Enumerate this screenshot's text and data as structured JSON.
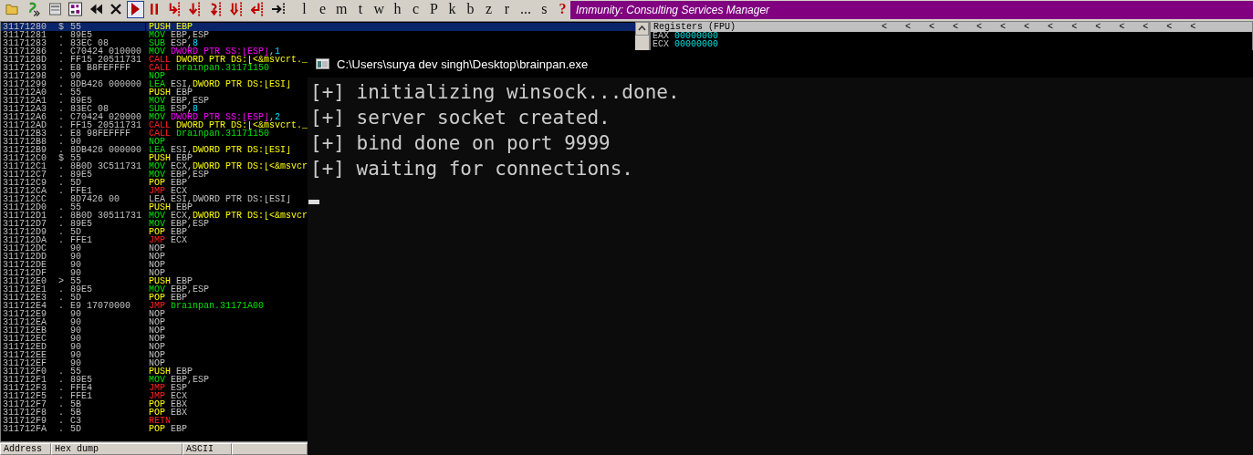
{
  "toolbar": {
    "icon_buttons": [
      {
        "kind": "open",
        "selected": false
      },
      {
        "kind": "script",
        "selected": false
      },
      {
        "kind": "window",
        "selected": false
      },
      {
        "kind": "grid",
        "selected": false
      },
      {
        "kind": "rewind",
        "selected": false
      },
      {
        "kind": "close",
        "selected": false
      },
      {
        "kind": "run",
        "selected": true
      },
      {
        "kind": "pause",
        "selected": false
      },
      {
        "kind": "step-into",
        "selected": false
      },
      {
        "kind": "step-over",
        "selected": false
      },
      {
        "kind": "trace-into",
        "selected": false
      },
      {
        "kind": "trace-over",
        "selected": false
      },
      {
        "kind": "run-to-return",
        "selected": false
      },
      {
        "kind": "go-to",
        "selected": false
      }
    ],
    "letter_buttons": [
      {
        "label": "l",
        "kind": "plain"
      },
      {
        "label": "e",
        "kind": "plain"
      },
      {
        "label": "m",
        "kind": "plain"
      },
      {
        "label": "t",
        "kind": "plain"
      },
      {
        "label": "w",
        "kind": "plain"
      },
      {
        "label": "h",
        "kind": "plain"
      },
      {
        "label": "c",
        "kind": "plain"
      },
      {
        "label": "P",
        "kind": "plain"
      },
      {
        "label": "k",
        "kind": "plain"
      },
      {
        "label": "b",
        "kind": "plain"
      },
      {
        "label": "z",
        "kind": "plain"
      },
      {
        "label": "r",
        "kind": "plain"
      },
      {
        "label": "...",
        "kind": "plain"
      },
      {
        "label": "s",
        "kind": "plain"
      },
      {
        "label": "?",
        "kind": "help"
      }
    ]
  },
  "window": {
    "title": "Immunity: Consulting Services Manager"
  },
  "disassembly": {
    "rows": [
      {
        "address": "31171280",
        "mark": "$",
        "hex": "55",
        "selected": true,
        "ins": [
          {
            "text": "PUSH EBP",
            "kind": "stack"
          }
        ]
      },
      {
        "address": "31171281",
        "mark": ".",
        "hex": "89E5",
        "selected": false,
        "ins": [
          {
            "text": "MOV",
            "kind": "op"
          },
          {
            "text": " EBP,ESP",
            "kind": "reg"
          }
        ]
      },
      {
        "address": "31171283",
        "mark": ".",
        "hex": "83EC 08",
        "selected": false,
        "ins": [
          {
            "text": "SUB",
            "kind": "op"
          },
          {
            "text": " ESP,",
            "kind": "reg"
          },
          {
            "text": "8",
            "kind": "imm"
          }
        ]
      },
      {
        "address": "31171286",
        "mark": ".",
        "hex": "C70424 010000",
        "selected": false,
        "ins": [
          {
            "text": "MOV",
            "kind": "op"
          },
          {
            "text": " DWORD PTR SS:[ESP]",
            "kind": "mem"
          },
          {
            "text": ",",
            "kind": "reg"
          },
          {
            "text": "1",
            "kind": "imm"
          }
        ]
      },
      {
        "address": "3117128D",
        "mark": ".",
        "hex": "FF15 20511731",
        "selected": false,
        "ins": [
          {
            "text": "CALL",
            "kind": "flow"
          },
          {
            "text": " DWORD PTR DS:[<&msvcrt._",
            "kind": "data"
          }
        ]
      },
      {
        "address": "31171293",
        "mark": ".",
        "hex": "E8 B8FEFFFF",
        "selected": false,
        "ins": [
          {
            "text": "CALL",
            "kind": "flow"
          },
          {
            "text": " brainpan.31171150",
            "kind": "label"
          }
        ]
      },
      {
        "address": "31171298",
        "mark": ".",
        "hex": "90",
        "selected": false,
        "ins": [
          {
            "text": "NOP",
            "kind": "op"
          }
        ]
      },
      {
        "address": "31171299",
        "mark": ".",
        "hex": "8DB426 000000",
        "selected": false,
        "ins": [
          {
            "text": "LEA",
            "kind": "op"
          },
          {
            "text": " ESI,",
            "kind": "reg"
          },
          {
            "text": "DWORD PTR DS:[ESI]",
            "kind": "data"
          }
        ]
      },
      {
        "address": "311712A0",
        "mark": ".",
        "hex": "55",
        "selected": false,
        "ins": [
          {
            "text": "PUSH",
            "kind": "stack"
          },
          {
            "text": " EBP",
            "kind": "reg"
          }
        ]
      },
      {
        "address": "311712A1",
        "mark": ".",
        "hex": "89E5",
        "selected": false,
        "ins": [
          {
            "text": "MOV",
            "kind": "op"
          },
          {
            "text": " EBP,ESP",
            "kind": "reg"
          }
        ]
      },
      {
        "address": "311712A3",
        "mark": ".",
        "hex": "83EC 08",
        "selected": false,
        "ins": [
          {
            "text": "SUB",
            "kind": "op"
          },
          {
            "text": " ESP,",
            "kind": "reg"
          },
          {
            "text": "8",
            "kind": "imm"
          }
        ]
      },
      {
        "address": "311712A6",
        "mark": ".",
        "hex": "C70424 020000",
        "selected": false,
        "ins": [
          {
            "text": "MOV",
            "kind": "op"
          },
          {
            "text": " DWORD PTR SS:[ESP]",
            "kind": "mem"
          },
          {
            "text": ",",
            "kind": "reg"
          },
          {
            "text": "2",
            "kind": "imm"
          }
        ]
      },
      {
        "address": "311712AD",
        "mark": ".",
        "hex": "FF15 20511731",
        "selected": false,
        "ins": [
          {
            "text": "CALL",
            "kind": "flow"
          },
          {
            "text": " DWORD PTR DS:[<&msvcrt._",
            "kind": "data"
          }
        ]
      },
      {
        "address": "311712B3",
        "mark": ".",
        "hex": "E8 98FEFFFF",
        "selected": false,
        "ins": [
          {
            "text": "CALL",
            "kind": "flow"
          },
          {
            "text": " brainpan.31171150",
            "kind": "label"
          }
        ]
      },
      {
        "address": "311712B8",
        "mark": ".",
        "hex": "90",
        "selected": false,
        "ins": [
          {
            "text": "NOP",
            "kind": "op"
          }
        ]
      },
      {
        "address": "311712B9",
        "mark": ".",
        "hex": "8DB426 000000",
        "selected": false,
        "ins": [
          {
            "text": "LEA",
            "kind": "op"
          },
          {
            "text": " ESI,",
            "kind": "reg"
          },
          {
            "text": "DWORD PTR DS:[ESI]",
            "kind": "data"
          }
        ]
      },
      {
        "address": "311712C0",
        "mark": "$",
        "hex": "55",
        "selected": false,
        "ins": [
          {
            "text": "PUSH",
            "kind": "stack"
          },
          {
            "text": " EBP",
            "kind": "reg"
          }
        ]
      },
      {
        "address": "311712C1",
        "mark": ".",
        "hex": "8B0D 3C511731",
        "selected": false,
        "ins": [
          {
            "text": "MOV",
            "kind": "op"
          },
          {
            "text": " ECX,",
            "kind": "reg"
          },
          {
            "text": "DWORD PTR DS:[<&msvcr",
            "kind": "data"
          }
        ]
      },
      {
        "address": "311712C7",
        "mark": ".",
        "hex": "89E5",
        "selected": false,
        "ins": [
          {
            "text": "MOV",
            "kind": "op"
          },
          {
            "text": " EBP,ESP",
            "kind": "reg"
          }
        ]
      },
      {
        "address": "311712C9",
        "mark": ".",
        "hex": "5D",
        "selected": false,
        "ins": [
          {
            "text": "POP",
            "kind": "stack"
          },
          {
            "text": " EBP",
            "kind": "reg"
          }
        ]
      },
      {
        "address": "311712CA",
        "mark": ".",
        "hex": "FFE1",
        "selected": false,
        "ins": [
          {
            "text": "JMP",
            "kind": "flow"
          },
          {
            "text": " ECX",
            "kind": "reg"
          }
        ]
      },
      {
        "address": "311712CC",
        "mark": "",
        "hex": "8D7426 00",
        "selected": false,
        "ins": [
          {
            "text": "LEA ESI,DWORD PTR DS:[ESI]",
            "kind": "reg"
          }
        ]
      },
      {
        "address": "311712D0",
        "mark": ".",
        "hex": "55",
        "selected": false,
        "ins": [
          {
            "text": "PUSH",
            "kind": "stack"
          },
          {
            "text": " EBP",
            "kind": "reg"
          }
        ]
      },
      {
        "address": "311712D1",
        "mark": ".",
        "hex": "8B0D 30511731",
        "selected": false,
        "ins": [
          {
            "text": "MOV",
            "kind": "op"
          },
          {
            "text": " ECX,",
            "kind": "reg"
          },
          {
            "text": "DWORD PTR DS:[<&msvcr",
            "kind": "data"
          }
        ]
      },
      {
        "address": "311712D7",
        "mark": ".",
        "hex": "89E5",
        "selected": false,
        "ins": [
          {
            "text": "MOV",
            "kind": "op"
          },
          {
            "text": " EBP,ESP",
            "kind": "reg"
          }
        ]
      },
      {
        "address": "311712D9",
        "mark": ".",
        "hex": "5D",
        "selected": false,
        "ins": [
          {
            "text": "POP",
            "kind": "stack"
          },
          {
            "text": " EBP",
            "kind": "reg"
          }
        ]
      },
      {
        "address": "311712DA",
        "mark": ".",
        "hex": "FFE1",
        "selected": false,
        "ins": [
          {
            "text": "JMP",
            "kind": "flow"
          },
          {
            "text": " ECX",
            "kind": "reg"
          }
        ]
      },
      {
        "address": "311712DC",
        "mark": "",
        "hex": "90",
        "selected": false,
        "ins": [
          {
            "text": "NOP",
            "kind": "reg"
          }
        ]
      },
      {
        "address": "311712DD",
        "mark": "",
        "hex": "90",
        "selected": false,
        "ins": [
          {
            "text": "NOP",
            "kind": "reg"
          }
        ]
      },
      {
        "address": "311712DE",
        "mark": "",
        "hex": "90",
        "selected": false,
        "ins": [
          {
            "text": "NOP",
            "kind": "reg"
          }
        ]
      },
      {
        "address": "311712DF",
        "mark": "",
        "hex": "90",
        "selected": false,
        "ins": [
          {
            "text": "NOP",
            "kind": "reg"
          }
        ]
      },
      {
        "address": "311712E0",
        "mark": ">",
        "hex": "55",
        "selected": false,
        "ins": [
          {
            "text": "PUSH",
            "kind": "stack"
          },
          {
            "text": " EBP",
            "kind": "reg"
          }
        ]
      },
      {
        "address": "311712E1",
        "mark": ".",
        "hex": "89E5",
        "selected": false,
        "ins": [
          {
            "text": "MOV",
            "kind": "op"
          },
          {
            "text": " EBP,ESP",
            "kind": "reg"
          }
        ]
      },
      {
        "address": "311712E3",
        "mark": ".",
        "hex": "5D",
        "selected": false,
        "ins": [
          {
            "text": "POP",
            "kind": "stack"
          },
          {
            "text": " EBP",
            "kind": "reg"
          }
        ]
      },
      {
        "address": "311712E4",
        "mark": ".",
        "hex": "E9 17070000",
        "selected": false,
        "ins": [
          {
            "text": "JMP",
            "kind": "flow"
          },
          {
            "text": " brainpan.31171A00",
            "kind": "label"
          }
        ]
      },
      {
        "address": "311712E9",
        "mark": "",
        "hex": "90",
        "selected": false,
        "ins": [
          {
            "text": "NOP",
            "kind": "reg"
          }
        ]
      },
      {
        "address": "311712EA",
        "mark": "",
        "hex": "90",
        "selected": false,
        "ins": [
          {
            "text": "NOP",
            "kind": "reg"
          }
        ]
      },
      {
        "address": "311712EB",
        "mark": "",
        "hex": "90",
        "selected": false,
        "ins": [
          {
            "text": "NOP",
            "kind": "reg"
          }
        ]
      },
      {
        "address": "311712EC",
        "mark": "",
        "hex": "90",
        "selected": false,
        "ins": [
          {
            "text": "NOP",
            "kind": "reg"
          }
        ]
      },
      {
        "address": "311712ED",
        "mark": "",
        "hex": "90",
        "selected": false,
        "ins": [
          {
            "text": "NOP",
            "kind": "reg"
          }
        ]
      },
      {
        "address": "311712EE",
        "mark": "",
        "hex": "90",
        "selected": false,
        "ins": [
          {
            "text": "NOP",
            "kind": "reg"
          }
        ]
      },
      {
        "address": "311712EF",
        "mark": "",
        "hex": "90",
        "selected": false,
        "ins": [
          {
            "text": "NOP",
            "kind": "reg"
          }
        ]
      },
      {
        "address": "311712F0",
        "mark": ".",
        "hex": "55",
        "selected": false,
        "ins": [
          {
            "text": "PUSH",
            "kind": "stack"
          },
          {
            "text": " EBP",
            "kind": "reg"
          }
        ]
      },
      {
        "address": "311712F1",
        "mark": ".",
        "hex": "89E5",
        "selected": false,
        "ins": [
          {
            "text": "MOV",
            "kind": "op"
          },
          {
            "text": " EBP,ESP",
            "kind": "reg"
          }
        ]
      },
      {
        "address": "311712F3",
        "mark": ".",
        "hex": "FFE4",
        "selected": false,
        "ins": [
          {
            "text": "JMP",
            "kind": "flow"
          },
          {
            "text": " ESP",
            "kind": "reg"
          }
        ]
      },
      {
        "address": "311712F5",
        "mark": ".",
        "hex": "FFE1",
        "selected": false,
        "ins": [
          {
            "text": "JMP",
            "kind": "flow"
          },
          {
            "text": " ECX",
            "kind": "reg"
          }
        ]
      },
      {
        "address": "311712F7",
        "mark": ".",
        "hex": "5B",
        "selected": false,
        "ins": [
          {
            "text": "POP",
            "kind": "stack"
          },
          {
            "text": " EBX",
            "kind": "reg"
          }
        ]
      },
      {
        "address": "311712F8",
        "mark": ".",
        "hex": "5B",
        "selected": false,
        "ins": [
          {
            "text": "POP",
            "kind": "stack"
          },
          {
            "text": " EBX",
            "kind": "reg"
          }
        ]
      },
      {
        "address": "311712F9",
        "mark": ".",
        "hex": "C3",
        "selected": false,
        "ins": [
          {
            "text": "RETN",
            "kind": "flow"
          }
        ]
      },
      {
        "address": "311712FA",
        "mark": ".",
        "hex": "5D",
        "selected": false,
        "ins": [
          {
            "text": "POP",
            "kind": "stack"
          },
          {
            "text": " EBP",
            "kind": "reg"
          }
        ]
      }
    ]
  },
  "registers": {
    "title": "Registers (FPU)",
    "markers": [
      "<",
      "<",
      "<",
      "<",
      "<",
      "<",
      "<",
      "<",
      "<",
      "<",
      "<",
      "<",
      "<",
      "<"
    ],
    "rows": [
      {
        "name": "EAX",
        "value": "00000000"
      },
      {
        "name": "ECX",
        "value": "00000000"
      }
    ]
  },
  "dump": {
    "columns": [
      "Address",
      "Hex dump",
      "ASCII"
    ]
  },
  "console": {
    "title": "C:\\Users\\surya dev singh\\Desktop\\brainpan.exe",
    "lines": [
      "[+] initializing winsock...done.",
      "[+] server socket created.",
      "[+] bind done on port 9999",
      "[+] waiting for connections."
    ],
    "cursor": true
  }
}
